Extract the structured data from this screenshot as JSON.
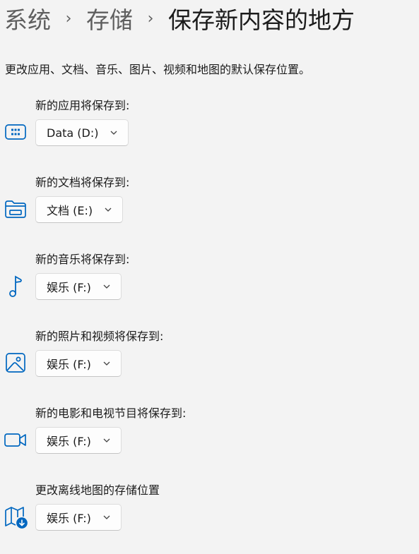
{
  "breadcrumb": {
    "level1": "系统",
    "level2": "存储",
    "current": "保存新内容的地方",
    "separator": "›"
  },
  "description": "更改应用、文档、音乐、图片、视频和地图的默认保存位置。",
  "accent_color": "#0067c0",
  "settings": [
    {
      "label": "新的应用将保存到:",
      "icon": "apps-icon",
      "value": "Data (D:)"
    },
    {
      "label": "新的文档将保存到:",
      "icon": "folder-icon",
      "value": "文档 (E:)"
    },
    {
      "label": "新的音乐将保存到:",
      "icon": "music-note-icon",
      "value": "娱乐 (F:)"
    },
    {
      "label": "新的照片和视频将保存到:",
      "icon": "photo-icon",
      "value": "娱乐 (F:)"
    },
    {
      "label": "新的电影和电视节目将保存到:",
      "icon": "video-camera-icon",
      "value": "娱乐 (F:)"
    },
    {
      "label": "更改离线地图的存储位置",
      "icon": "offline-map-icon",
      "value": "娱乐 (F:)"
    }
  ]
}
